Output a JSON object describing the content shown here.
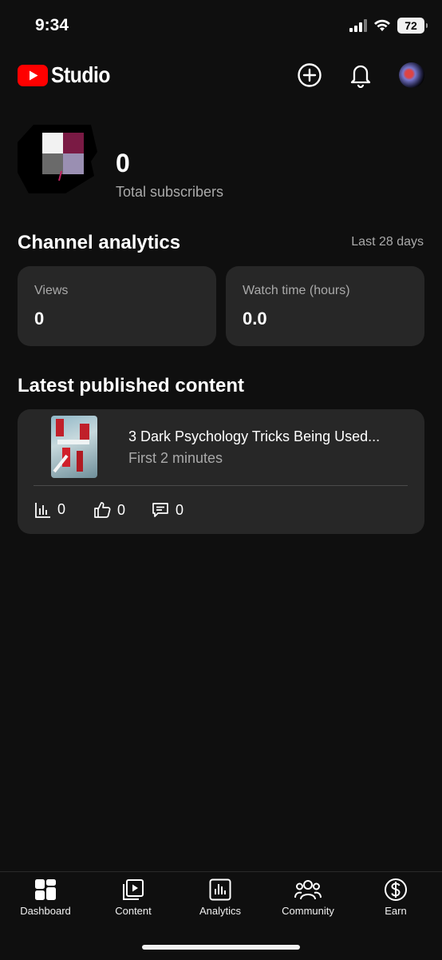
{
  "status_bar": {
    "time": "9:34",
    "battery": "72"
  },
  "header": {
    "brand": "Studio"
  },
  "channel": {
    "subscriber_count": "0",
    "subscriber_label": "Total subscribers"
  },
  "analytics": {
    "title": "Channel analytics",
    "range": "Last 28 days",
    "metrics": [
      {
        "label": "Views",
        "value": "0"
      },
      {
        "label": "Watch time (hours)",
        "value": "0.0"
      }
    ]
  },
  "latest": {
    "title": "Latest published content",
    "video": {
      "title": "3 Dark Psychology Tricks Being Used...",
      "subtitle": "First 2 minutes",
      "views": "0",
      "likes": "0",
      "comments": "0"
    }
  },
  "nav": {
    "items": [
      {
        "label": "Dashboard",
        "icon": "dashboard-icon"
      },
      {
        "label": "Content",
        "icon": "content-icon"
      },
      {
        "label": "Analytics",
        "icon": "analytics-icon"
      },
      {
        "label": "Community",
        "icon": "community-icon"
      },
      {
        "label": "Earn",
        "icon": "earn-icon"
      }
    ]
  },
  "colors": {
    "background": "#0f0f0f",
    "card": "#272727",
    "brand_red": "#ff0000",
    "muted_text": "#aaaaaa"
  }
}
